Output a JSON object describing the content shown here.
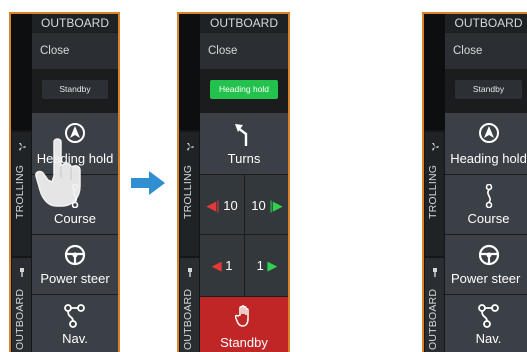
{
  "panels": [
    {
      "header": "OUTBOARD",
      "close": "Close",
      "mode": "Standby",
      "side_labels": [
        "TROLLING",
        "OUTBOARD"
      ],
      "buttons": [
        "Heading hold",
        "Course",
        "Power steer",
        "Nav."
      ]
    },
    {
      "header": "OUTBOARD",
      "close": "Close",
      "mode": "Heading hold",
      "side_labels": [
        "TROLLING",
        "OUTBOARD"
      ],
      "turns": "Turns",
      "adjust_left_10": "10",
      "adjust_right_10": "10",
      "adjust_left_1": "1",
      "adjust_right_1": "1",
      "standby": "Standby"
    },
    {
      "header": "OUTBOARD",
      "close": "Close",
      "mode": "Standby",
      "side_labels": [
        "TROLLING",
        "OUTBOARD"
      ],
      "buttons": [
        "Heading hold",
        "Course",
        "Power steer",
        "Nav."
      ]
    }
  ],
  "colors": {
    "frame": "#d8832a",
    "active_mode": "#22c24c",
    "standby_red": "#c02626",
    "arrow_blue": "#2f8fd0"
  }
}
